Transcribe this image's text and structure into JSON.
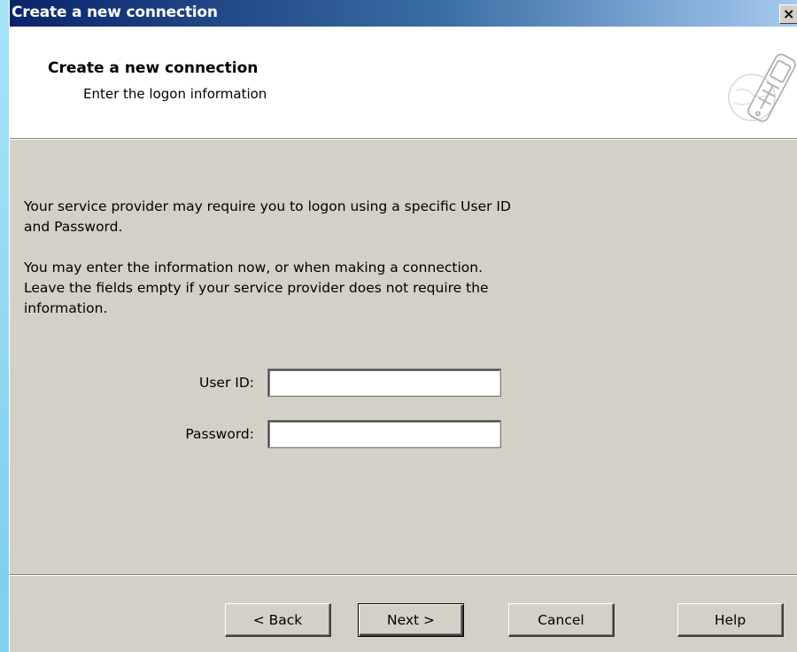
{
  "window": {
    "title": "Create a new connection",
    "close_label": "×"
  },
  "header": {
    "title": "Create a new connection",
    "subtitle": "Enter the logon information",
    "icon": "mobile-phone-icon"
  },
  "body": {
    "paragraph1": "Your service provider may require you to logon using a specific User ID\nand Password.",
    "paragraph2": "You may enter the information now, or when making a connection.\nLeave the fields empty if your service provider does not require the\ninformation."
  },
  "form": {
    "user_id_label": "User ID:",
    "user_id_value": "",
    "password_label": "Password:",
    "password_value": ""
  },
  "buttons": {
    "back": "< Back",
    "next": "Next >",
    "cancel": "Cancel",
    "help": "Help"
  }
}
